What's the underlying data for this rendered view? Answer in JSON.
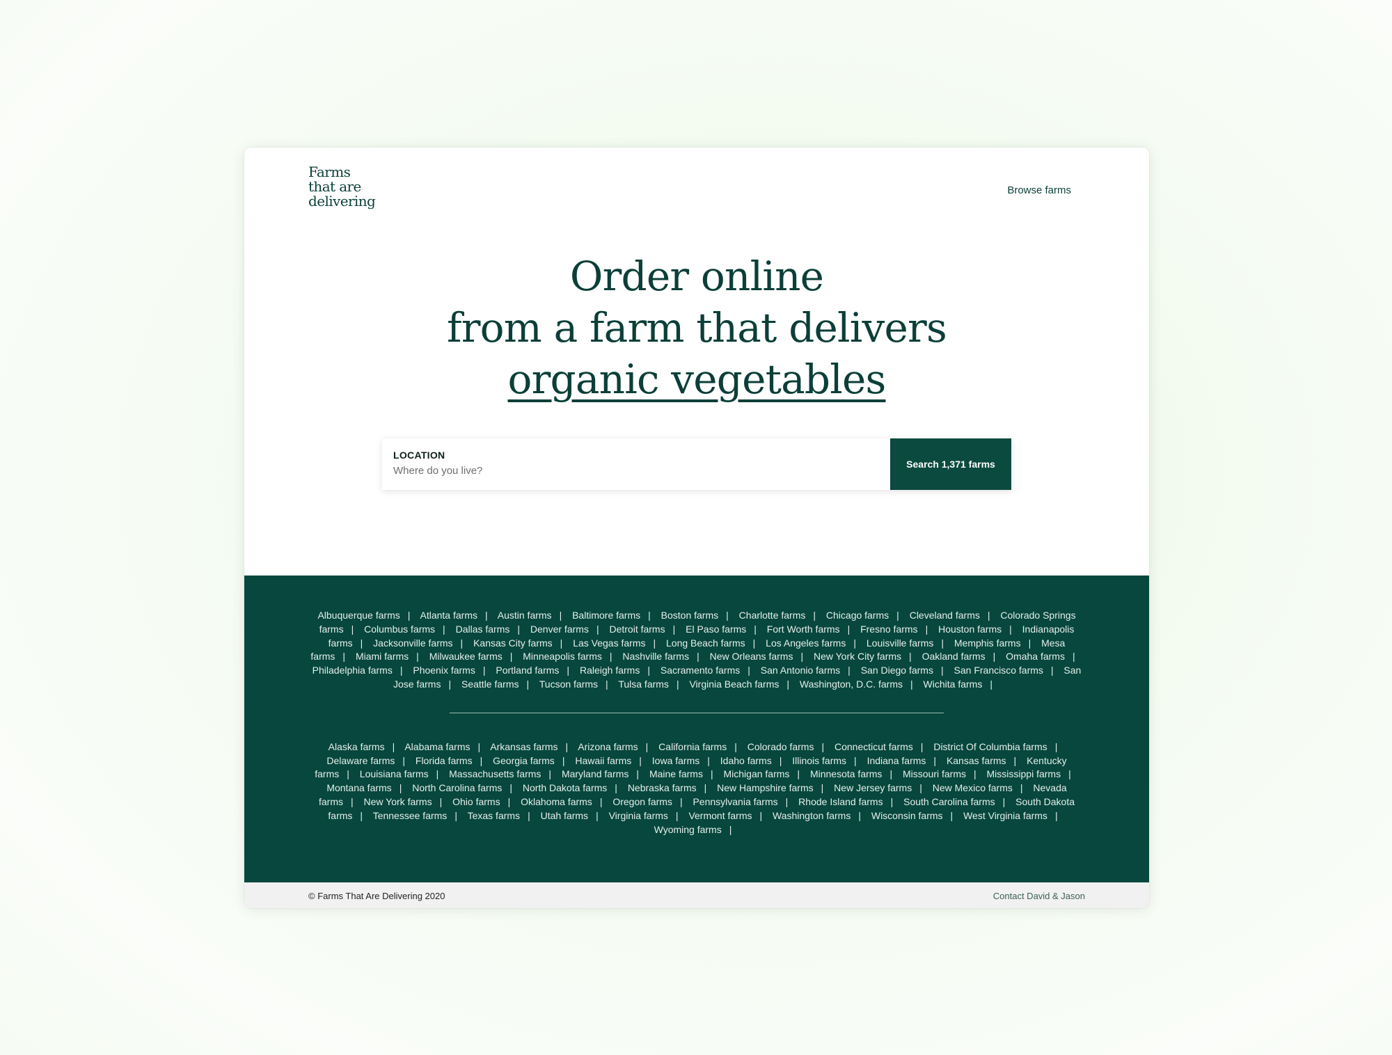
{
  "header": {
    "logo_lines": [
      "Farms",
      "that are",
      "delivering"
    ],
    "nav_browse": "Browse farms"
  },
  "hero": {
    "line1": "Order online",
    "line2": "from a farm that delivers",
    "highlight": "organic vegetables"
  },
  "search": {
    "label": "LOCATION",
    "placeholder": "Where do you live?",
    "button": "Search 1,371 farms"
  },
  "cities": [
    "Albuquerque farms",
    "Atlanta farms",
    "Austin farms",
    "Baltimore farms",
    "Boston farms",
    "Charlotte farms",
    "Chicago farms",
    "Cleveland farms",
    "Colorado Springs farms",
    "Columbus farms",
    "Dallas farms",
    "Denver farms",
    "Detroit farms",
    "El Paso farms",
    "Fort Worth farms",
    "Fresno farms",
    "Houston farms",
    "Indianapolis farms",
    "Jacksonville farms",
    "Kansas City farms",
    "Las Vegas farms",
    "Long Beach farms",
    "Los Angeles farms",
    "Louisville farms",
    "Memphis farms",
    "Mesa farms",
    "Miami farms",
    "Milwaukee farms",
    "Minneapolis farms",
    "Nashville farms",
    "New Orleans farms",
    "New York City farms",
    "Oakland farms",
    "Omaha farms",
    "Philadelphia farms",
    "Phoenix farms",
    "Portland farms",
    "Raleigh farms",
    "Sacramento farms",
    "San Antonio farms",
    "San Diego farms",
    "San Francisco farms",
    "San Jose farms",
    "Seattle farms",
    "Tucson farms",
    "Tulsa farms",
    "Virginia Beach farms",
    "Washington, D.C. farms",
    "Wichita farms"
  ],
  "states": [
    "Alaska farms",
    "Alabama farms",
    "Arkansas farms",
    "Arizona farms",
    "California farms",
    "Colorado farms",
    "Connecticut farms",
    "District Of Columbia farms",
    "Delaware farms",
    "Florida farms",
    "Georgia farms",
    "Hawaii farms",
    "Iowa farms",
    "Idaho farms",
    "Illinois farms",
    "Indiana farms",
    "Kansas farms",
    "Kentucky farms",
    "Louisiana farms",
    "Massachusetts farms",
    "Maryland farms",
    "Maine farms",
    "Michigan farms",
    "Minnesota farms",
    "Missouri farms",
    "Mississippi farms",
    "Montana farms",
    "North Carolina farms",
    "North Dakota farms",
    "Nebraska farms",
    "New Hampshire farms",
    "New Jersey farms",
    "New Mexico farms",
    "Nevada farms",
    "New York farms",
    "Ohio farms",
    "Oklahoma farms",
    "Oregon farms",
    "Pennsylvania farms",
    "Rhode Island farms",
    "South Carolina farms",
    "South Dakota farms",
    "Tennessee farms",
    "Texas farms",
    "Utah farms",
    "Virginia farms",
    "Vermont farms",
    "Washington farms",
    "Wisconsin farms",
    "West Virginia farms",
    "Wyoming farms"
  ],
  "separator": "|",
  "footer": {
    "copyright": "© Farms That Are Delivering 2020",
    "contact": "Contact David & Jason"
  },
  "colors": {
    "brand_green": "#0b3f38",
    "links_background": "#07473d",
    "button_background": "#0b4a3f",
    "footer_background": "#f1f1f1"
  }
}
